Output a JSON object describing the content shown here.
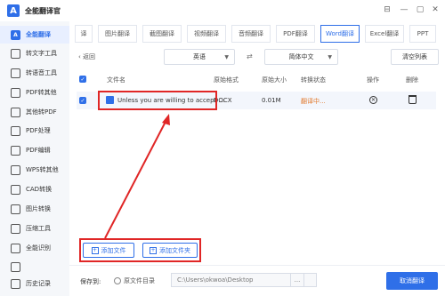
{
  "app": {
    "title": "全能翻译官",
    "logo": "A"
  },
  "window_controls": [
    "⊟",
    "—",
    "▢",
    "✕"
  ],
  "sidebar": {
    "items": [
      {
        "label": "全能翻译",
        "icon": "translate-icon",
        "active": true
      },
      {
        "label": "转文字工具",
        "icon": "text-tool-icon"
      },
      {
        "label": "转语音工具",
        "icon": "speech-tool-icon"
      },
      {
        "label": "PDF转其他",
        "icon": "pdf-convert-icon"
      },
      {
        "label": "其他转PDF",
        "icon": "to-pdf-icon"
      },
      {
        "label": "PDF处理",
        "icon": "pdf-process-icon"
      },
      {
        "label": "PDF编辑",
        "icon": "pdf-edit-icon"
      },
      {
        "label": "WPS转其他",
        "icon": "wps-icon"
      },
      {
        "label": "CAD转换",
        "icon": "cad-icon"
      },
      {
        "label": "图片转换",
        "icon": "image-convert-icon"
      },
      {
        "label": "压缩工具",
        "icon": "compress-icon"
      },
      {
        "label": "全能识别",
        "icon": "recognize-icon"
      },
      {
        "label": "",
        "icon": "more-tool-icon"
      },
      {
        "label": "历史记录",
        "icon": "history-icon"
      }
    ]
  },
  "tabs": [
    "译",
    "图片翻译",
    "截图翻译",
    "视频翻译",
    "音频翻译",
    "PDF翻译",
    "Word翻译",
    "Excel翻译",
    "PPT"
  ],
  "active_tab": "Word翻译",
  "toolbar": {
    "back": "‹ 返回",
    "source_lang": "英语",
    "swap": "⇄",
    "target_lang": "简体中文",
    "clear": "清空列表"
  },
  "table": {
    "columns": [
      "文件名",
      "原始格式",
      "原始大小",
      "转换状态",
      "操作",
      "删除"
    ],
    "rows": [
      {
        "name": "Unless you are willing to accept ...",
        "format": "DOCX",
        "size": "0.01M",
        "status": "翻译中..."
      }
    ]
  },
  "buttons": {
    "add_file": "添加文件",
    "add_folder": "添加文件夹",
    "translate": "取消翻译"
  },
  "footer": {
    "save_to": "保存到:",
    "source_dir": "原文件目录",
    "path": "C:\\Users\\okwoa\\Desktop",
    "browse": "..."
  },
  "colors": {
    "accent": "#2f6fe8",
    "annotation": "#e02626",
    "status": "#e27a2e"
  }
}
